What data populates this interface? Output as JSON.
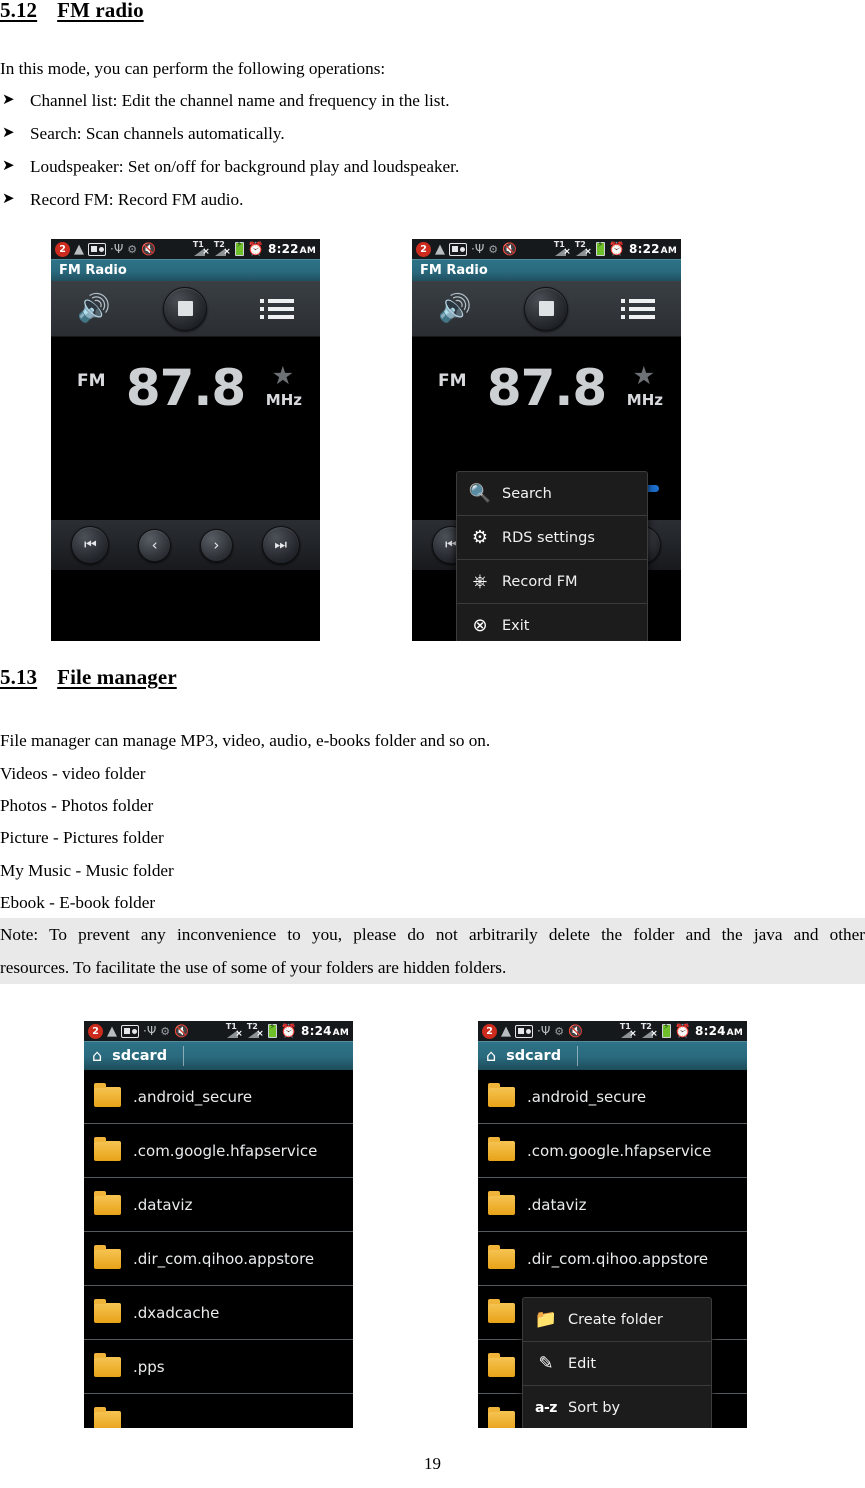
{
  "document": {
    "section_fm": {
      "number": "5.12",
      "title": "FM radio",
      "intro": "In this mode, you can perform the following operations:",
      "bullet_glyph": "➤",
      "bullets": [
        "Channel list: Edit the channel name and frequency in the list.",
        "Search: Scan channels automatically.",
        "Loudspeaker: Set on/off for background play and loudspeaker.",
        "Record FM: Record FM audio."
      ]
    },
    "section_file": {
      "number": "5.13",
      "title": "File manager",
      "intro": "File manager can manage MP3, video, audio, e-books folder and so on.",
      "lines": [
        "Videos - video folder",
        "Photos - Photos folder",
        "Picture - Pictures folder",
        "My Music - Music folder",
        "Ebook - E-book folder"
      ],
      "note_line1": "Note: To prevent any inconvenience to you, please do not arbitrarily delete the folder and the java and other",
      "note_line2": "resources. To facilitate the use of some of your folders are hidden folders."
    },
    "page_number": "19"
  },
  "fm_screenshot": {
    "status_bar": {
      "notification_count": "2",
      "time": "8:22",
      "ampm": "AM",
      "icons": [
        "notification-badge-icon",
        "warning-triangle-icon",
        "fm-radio-icon",
        "usb-icon",
        "android-robot-icon",
        "mute-speaker-icon",
        "sim1-signal-no-service-icon",
        "sim2-signal-no-service-icon",
        "battery-charging-icon",
        "alarm-clock-icon"
      ],
      "sim1_label": "T1",
      "sim2_label": "T2",
      "signal_x": "×"
    },
    "title": "FM Radio",
    "toolbar": {
      "speaker_glyph": "🔊",
      "stop_label": "stop-button",
      "list_label": "channel-list-button"
    },
    "display": {
      "band_label": "FM",
      "frequency": "87.8",
      "unit": "MHz",
      "star_glyph": "★"
    },
    "transport": {
      "prev_track": "⏮",
      "step_down": "‹",
      "step_up": "›",
      "next_track": "⏭"
    }
  },
  "fm_menu": {
    "items": [
      {
        "label": "Search",
        "icon": "search-icon",
        "glyph": "🔍"
      },
      {
        "label": "RDS settings",
        "icon": "gear-icon",
        "glyph": "⚙"
      },
      {
        "label": "Record FM",
        "icon": "microphone-icon",
        "glyph": "🎙"
      },
      {
        "label": "Exit",
        "icon": "exit-circle-x-icon",
        "glyph": "⊗"
      }
    ]
  },
  "file_screenshot": {
    "status_bar": {
      "notification_count": "2",
      "time": "8:24",
      "ampm": "AM",
      "sim1_label": "T1",
      "sim2_label": "T2",
      "signal_x": "×"
    },
    "breadcrumb": {
      "home_glyph": "⌂",
      "path": "sdcard"
    },
    "folders": [
      ".android_secure",
      ".com.google.hfapservice",
      ".dataviz",
      ".dir_com.qihoo.appstore",
      ".dxadcache",
      ".pps"
    ]
  },
  "file_menu": {
    "items": [
      {
        "label": "Create folder",
        "icon": "create-folder-icon",
        "glyph": "📁"
      },
      {
        "label": "Edit",
        "icon": "pencil-edit-icon",
        "glyph": "✎"
      },
      {
        "label": "Sort by",
        "icon": "sort-az-icon",
        "glyph": "a-z"
      }
    ]
  },
  "colors": {
    "title_bar": "#2a6a7e",
    "folder_icon": "#e8a317",
    "battery": "#6fbf2a",
    "notification_badge": "#cc2b1d",
    "note_highlight": "#e9e9e9",
    "seekbar": "#1c6fd0"
  }
}
